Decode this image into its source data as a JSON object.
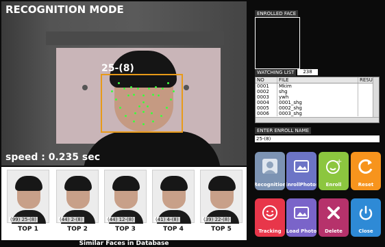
{
  "mode_title": "RECOGNITION MODE",
  "detected_label": "25-(8)",
  "speed_text": "speed : 0.235 sec",
  "similar": {
    "title": "Similar Faces in Database",
    "items": [
      {
        "caption": "(99) 25-(8)",
        "rank": "TOP 1"
      },
      {
        "caption": "(44) 2-(8)",
        "rank": "TOP 2"
      },
      {
        "caption": "(44) 12-(8)",
        "rank": "TOP 3"
      },
      {
        "caption": "(41) 4-(8)",
        "rank": "TOP 4"
      },
      {
        "caption": "(39) 22-(8)",
        "rank": "TOP 5"
      }
    ]
  },
  "enrolled_face_label": "ENROLLED FACE",
  "watching_list": {
    "label": "WATCHING LIST",
    "count": "238",
    "columns": [
      "NO",
      "FILE",
      "RESU"
    ],
    "rows": [
      [
        "0001",
        "Mkim",
        ""
      ],
      [
        "0002",
        "shg",
        ""
      ],
      [
        "0003",
        "ywh",
        ""
      ],
      [
        "0004",
        "0001_shg",
        ""
      ],
      [
        "0005",
        "0002_shg",
        ""
      ],
      [
        "0006",
        "0003_shg",
        ""
      ]
    ]
  },
  "enroll_name": {
    "label": "ENTER ENROLL NAME",
    "value": "25-(8)"
  },
  "buttons": [
    {
      "label": "Recognition",
      "icon": "person-icon",
      "color": "#7c93b3"
    },
    {
      "label": "EnrollPhotos",
      "icon": "photo-icon",
      "color": "#6c74c6"
    },
    {
      "label": "Enroll",
      "icon": "smiley-plus-icon",
      "color": "#8cc63f"
    },
    {
      "label": "Reset",
      "icon": "refresh-icon",
      "color": "#f7941d"
    },
    {
      "label": "Tracking",
      "icon": "smiley-icon",
      "color": "#e8364a"
    },
    {
      "label": "Load Photo",
      "icon": "photo-icon",
      "color": "#7a64c9"
    },
    {
      "label": "Delete",
      "icon": "x-icon",
      "color": "#b6326b"
    },
    {
      "label": "Close",
      "icon": "power-icon",
      "color": "#2e8ad6"
    }
  ]
}
